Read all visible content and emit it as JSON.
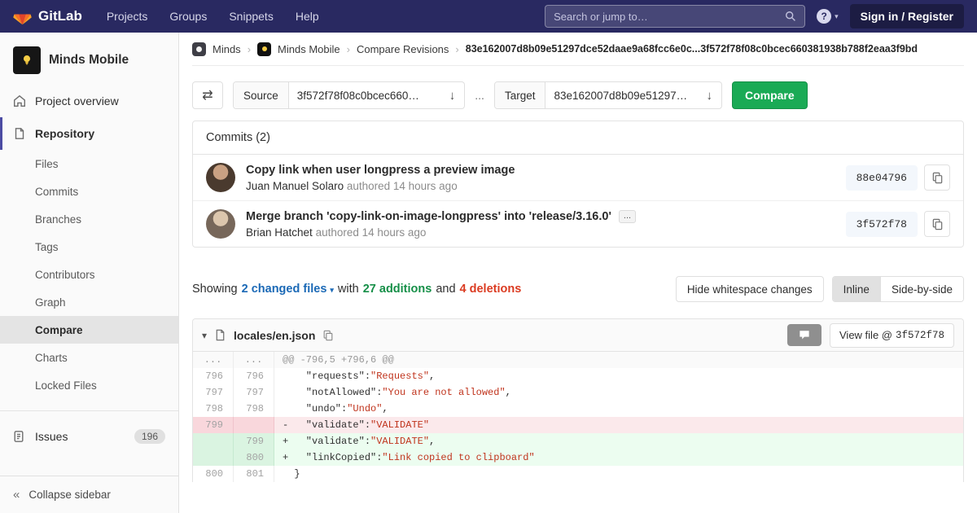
{
  "navbar": {
    "brand": "GitLab",
    "links": [
      "Projects",
      "Groups",
      "Snippets",
      "Help"
    ],
    "search_placeholder": "Search or jump to…",
    "sign_in": "Sign in / Register"
  },
  "icons": {
    "swap": "⇄",
    "dropdown_arrow": "↓",
    "caret_down": "▾",
    "breadcrumb_separator": "›",
    "help": "?",
    "collapse": "«",
    "ellipsis": "..."
  },
  "colors": {
    "navbar_bg": "#292961",
    "button_green": "#1aaa55",
    "link_blue": "#1b69b6",
    "addition_green": "#168f48",
    "deletion_red": "#db3b21"
  },
  "sidebar": {
    "project_name": "Minds Mobile",
    "overview": "Project overview",
    "repository": "Repository",
    "repo_items": [
      "Files",
      "Commits",
      "Branches",
      "Tags",
      "Contributors",
      "Graph",
      "Compare",
      "Charts",
      "Locked Files"
    ],
    "active_item": "Compare",
    "issues_label": "Issues",
    "issues_count": "196",
    "collapse": "Collapse sidebar"
  },
  "breadcrumb": {
    "items": [
      "Minds",
      "Minds Mobile",
      "Compare Revisions"
    ],
    "sha_range": "83e162007d8b09e51297dce52daae9a68fcc6e0c...3f572f78f08c0bcec660381938b788f2eaa3f9bd"
  },
  "compare_form": {
    "source_label": "Source",
    "source_value": "3f572f78f08c0bcec660…",
    "dots": "...",
    "target_label": "Target",
    "target_value": "83e162007d8b09e51297…",
    "compare_button": "Compare"
  },
  "commits": {
    "header": "Commits (2)",
    "items": [
      {
        "title": "Copy link when user longpress a preview image",
        "author": "Juan Manuel Solaro",
        "meta": "authored 14 hours ago",
        "sha": "88e04796"
      },
      {
        "title": "Merge branch 'copy-link-on-image-longpress' into 'release/3.16.0'",
        "author": "Brian Hatchet",
        "meta": "authored 14 hours ago",
        "sha": "3f572f78"
      }
    ]
  },
  "summary": {
    "showing": "Showing",
    "changed_files": "2 changed files",
    "with": "with",
    "additions": "27 additions",
    "and": "and",
    "deletions": "4 deletions",
    "hide_whitespace": "Hide whitespace changes",
    "inline": "Inline",
    "side_by_side": "Side-by-side"
  },
  "diff": {
    "file_name": "locales/en.json",
    "view_file": "View file @",
    "view_file_sha": "3f572f78",
    "rows": [
      {
        "type": "hunk",
        "old": "...",
        "new": "...",
        "segs": [
          {
            "c": "hunk",
            "t": "@@ -796,5 +796,6 @@"
          }
        ]
      },
      {
        "type": "ctx",
        "old": "796",
        "new": "796",
        "segs": [
          {
            "c": "pln",
            "t": "    \"requests\":"
          },
          {
            "c": "str",
            "t": "\"Requests\""
          },
          {
            "c": "pln",
            "t": ","
          }
        ]
      },
      {
        "type": "ctx",
        "old": "797",
        "new": "797",
        "segs": [
          {
            "c": "pln",
            "t": "    \"notAllowed\":"
          },
          {
            "c": "str",
            "t": "\"You are not allowed\""
          },
          {
            "c": "pln",
            "t": ","
          }
        ]
      },
      {
        "type": "ctx",
        "old": "798",
        "new": "798",
        "segs": [
          {
            "c": "pln",
            "t": "    \"undo\":"
          },
          {
            "c": "str",
            "t": "\"Undo\""
          },
          {
            "c": "pln",
            "t": ","
          }
        ]
      },
      {
        "type": "del",
        "old": "799",
        "new": "",
        "segs": [
          {
            "c": "pln",
            "t": "-   \"validate\":"
          },
          {
            "c": "str",
            "t": "\"VALIDATE\""
          }
        ]
      },
      {
        "type": "add",
        "old": "",
        "new": "799",
        "segs": [
          {
            "c": "pln",
            "t": "+   \"validate\":"
          },
          {
            "c": "str",
            "t": "\"VALIDATE\""
          },
          {
            "c": "pln",
            "t": ","
          }
        ]
      },
      {
        "type": "add",
        "old": "",
        "new": "800",
        "segs": [
          {
            "c": "pln",
            "t": "+   \"linkCopied\":"
          },
          {
            "c": "str",
            "t": "\"Link copied to clipboard\""
          }
        ]
      },
      {
        "type": "ctx",
        "old": "800",
        "new": "801",
        "segs": [
          {
            "c": "pln",
            "t": "  }"
          }
        ]
      }
    ]
  }
}
